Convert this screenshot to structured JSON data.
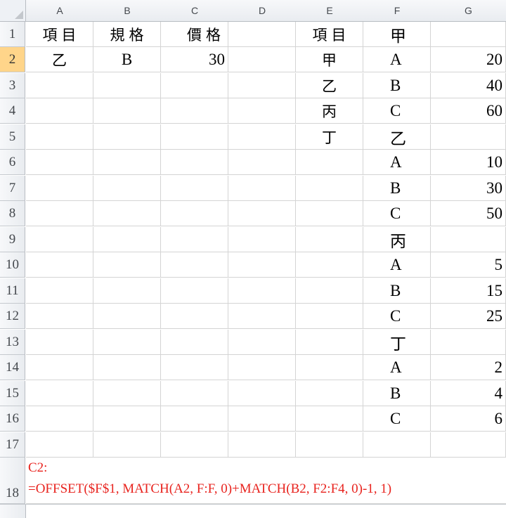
{
  "columns": [
    "A",
    "B",
    "C",
    "D",
    "E",
    "F",
    "G"
  ],
  "rows": [
    {
      "n": "1",
      "A": "項目",
      "B": "規格",
      "C": "價格",
      "D": "",
      "E": "項目",
      "F": "甲",
      "G": ""
    },
    {
      "n": "2",
      "A": "乙",
      "B": "B",
      "C": "30",
      "D": "",
      "E": "甲",
      "F": "A",
      "G": "20"
    },
    {
      "n": "3",
      "A": "",
      "B": "",
      "C": "",
      "D": "",
      "E": "乙",
      "F": "B",
      "G": "40"
    },
    {
      "n": "4",
      "A": "",
      "B": "",
      "C": "",
      "D": "",
      "E": "丙",
      "F": "C",
      "G": "60"
    },
    {
      "n": "5",
      "A": "",
      "B": "",
      "C": "",
      "D": "",
      "E": "丁",
      "F": "乙",
      "G": ""
    },
    {
      "n": "6",
      "A": "",
      "B": "",
      "C": "",
      "D": "",
      "E": "",
      "F": "A",
      "G": "10"
    },
    {
      "n": "7",
      "A": "",
      "B": "",
      "C": "",
      "D": "",
      "E": "",
      "F": "B",
      "G": "30"
    },
    {
      "n": "8",
      "A": "",
      "B": "",
      "C": "",
      "D": "",
      "E": "",
      "F": "C",
      "G": "50"
    },
    {
      "n": "9",
      "A": "",
      "B": "",
      "C": "",
      "D": "",
      "E": "",
      "F": "丙",
      "G": ""
    },
    {
      "n": "10",
      "A": "",
      "B": "",
      "C": "",
      "D": "",
      "E": "",
      "F": "A",
      "G": "5"
    },
    {
      "n": "11",
      "A": "",
      "B": "",
      "C": "",
      "D": "",
      "E": "",
      "F": "B",
      "G": "15"
    },
    {
      "n": "12",
      "A": "",
      "B": "",
      "C": "",
      "D": "",
      "E": "",
      "F": "C",
      "G": "25"
    },
    {
      "n": "13",
      "A": "",
      "B": "",
      "C": "",
      "D": "",
      "E": "",
      "F": "丁",
      "G": ""
    },
    {
      "n": "14",
      "A": "",
      "B": "",
      "C": "",
      "D": "",
      "E": "",
      "F": "A",
      "G": "2"
    },
    {
      "n": "15",
      "A": "",
      "B": "",
      "C": "",
      "D": "",
      "E": "",
      "F": "B",
      "G": "4"
    },
    {
      "n": "16",
      "A": "",
      "B": "",
      "C": "",
      "D": "",
      "E": "",
      "F": "C",
      "G": "6"
    },
    {
      "n": "17",
      "A": "",
      "B": "",
      "C": "",
      "D": "",
      "E": "",
      "F": "",
      "G": ""
    }
  ],
  "note": {
    "row": "18",
    "label": "C2:",
    "formula": "=OFFSET($F$1, MATCH(A2, F:F, 0)+MATCH(B2, F2:F4, 0)-1, 1)"
  },
  "colors": {
    "formula_text": "#e8231e",
    "active_row_header": "#ffd58a"
  }
}
